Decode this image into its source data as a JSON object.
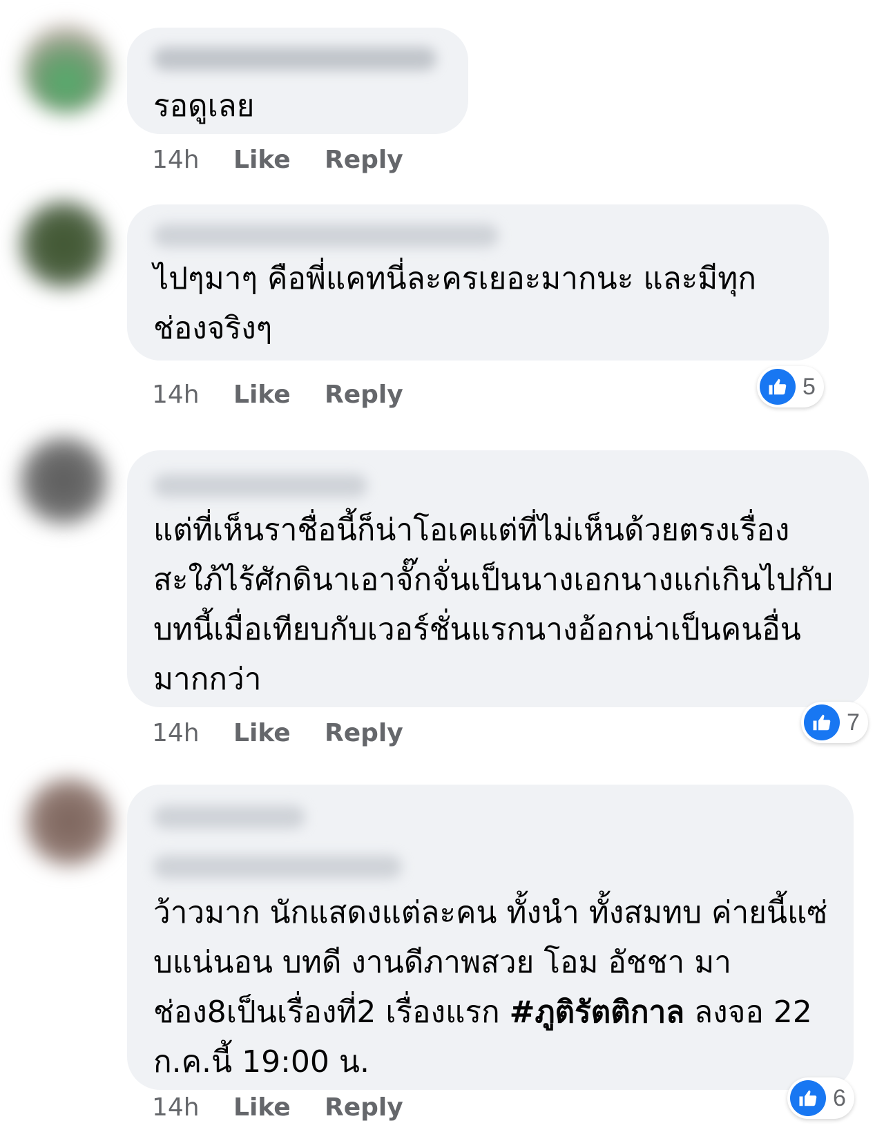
{
  "comments": [
    {
      "text": "รอดูเลย",
      "time": "14h",
      "like_label": "Like",
      "reply_label": "Reply",
      "reaction_count": null
    },
    {
      "text": "ไปๆมาๆ คือพี่แคทนี่ละครเยอะมากนะ และมีทุกช่องจริงๆ",
      "time": "14h",
      "like_label": "Like",
      "reply_label": "Reply",
      "reaction_count": "5"
    },
    {
      "text": "แต่ที่เห็นราชื่อนี้ก็น่าโอเคแต่ที่ไม่เห็นด้วยตรงเรื่องสะใภ้ไร้ศักดินาเอาจั๊กจั่นเป็นนางเอกนางแก่เกินไปกับบทนี้เมื่อเทียบกับเวอร์ชั่นแรกนางอ้อกน่าเป็นคนอื่นมากกว่า",
      "time": "14h",
      "like_label": "Like",
      "reply_label": "Reply",
      "reaction_count": "7"
    },
    {
      "text_before": "ว้าวมาก นักแสดงแต่ละคน ทั้งนำ ทั้งสมทบ ค่ายนี้แซ่บแน่นอน บทดี งานดีภาพสวย โอม อัชชา มาช่อง8เป็นเรื่องที่2 เรื่องแรก ",
      "hashtag": "#ภูติรัตติกาล",
      "text_after": " ลงจอ 22 ก.ค.นี้ 19:00 น.",
      "time": "14h",
      "like_label": "Like",
      "reply_label": "Reply",
      "reaction_count": "6"
    }
  ],
  "colors": {
    "bubble": "#f0f2f5",
    "meta_text": "#65676b",
    "like_blue": "#1877f2"
  },
  "icons": {
    "reaction": "thumbs-up-icon"
  }
}
